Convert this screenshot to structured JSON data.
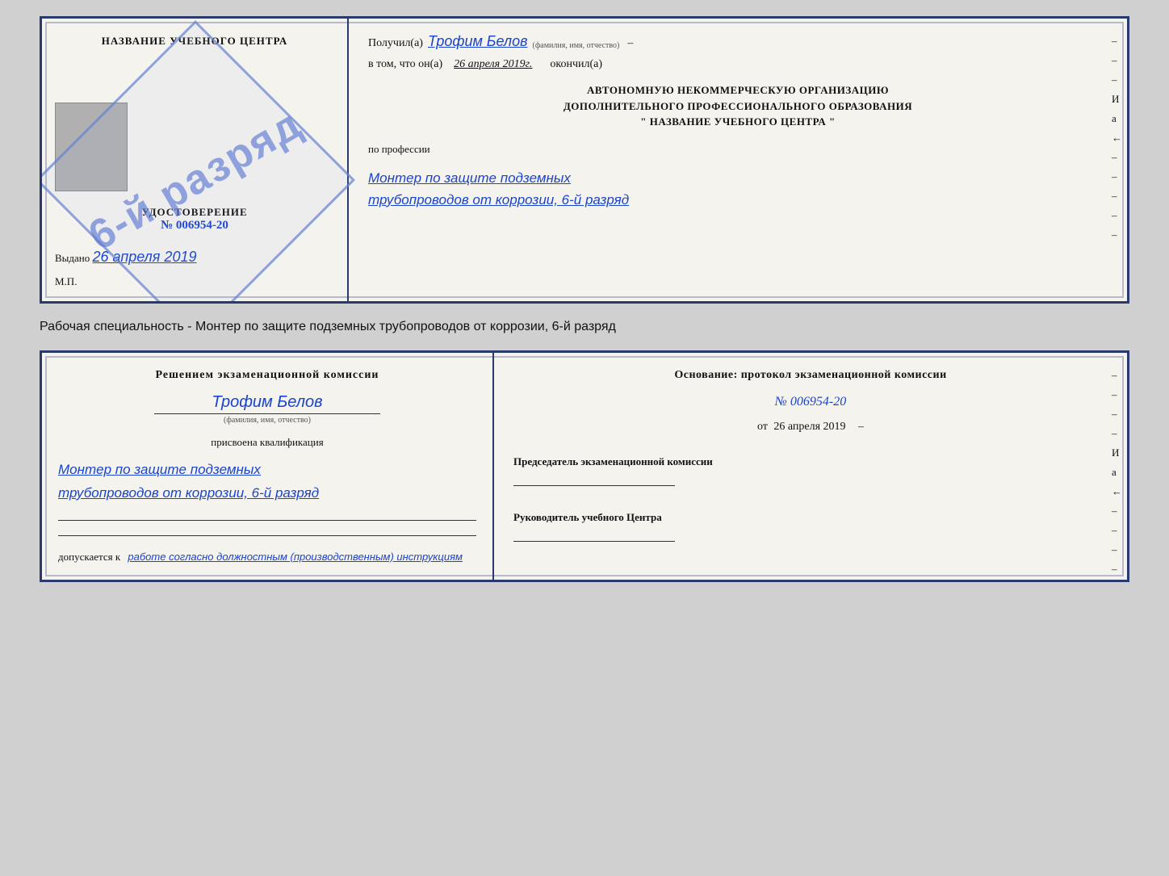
{
  "top_cert": {
    "left": {
      "heading": "НАЗВАНИЕ УЧЕБНОГО ЦЕНТРА",
      "photo_alt": "фото",
      "stamp_text": "6-й разряд",
      "udost_title": "УДОСТОВЕРЕНИЕ",
      "udost_num": "№ 006954-20",
      "vydano_label": "Выдано",
      "vydano_date": "26 апреля 2019",
      "mp": "М.П."
    },
    "right": {
      "poluchil_label": "Получил(а)",
      "recipient_name": "Трофим Белов",
      "fio_label": "(фамилия, имя, отчество)",
      "vtom_label": "в том, что он(а)",
      "vtom_date": "26 апреля 2019г.",
      "okonchil": "окончил(а)",
      "org_line1": "АВТОНОМНУЮ НЕКОММЕРЧЕСКУЮ ОРГАНИЗАЦИЮ",
      "org_line2": "ДОПОЛНИТЕЛЬНОГО ПРОФЕССИОНАЛЬНОГО ОБРАЗОВАНИЯ",
      "org_line3": "\"    НАЗВАНИЕ УЧЕБНОГО ЦЕНТРА    \"",
      "po_professii": "по профессии",
      "profession_line1": "Монтер по защите подземных",
      "profession_line2": "трубопроводов от коррозии, 6-й разряд",
      "dashes": [
        "-",
        "-",
        "-",
        "И",
        "а",
        "←",
        "-",
        "-",
        "-",
        "-",
        "-"
      ]
    }
  },
  "middle": {
    "text": "Рабочая специальность - Монтер по защите подземных трубопроводов от коррозии, 6-й разряд"
  },
  "bottom_cert": {
    "left": {
      "heading": "Решением экзаменационной комиссии",
      "name": "Трофим Белов",
      "fio_label": "(фамилия, имя, отчество)",
      "prisvoena": "присвоена квалификация",
      "qualification_line1": "Монтер по защите подземных",
      "qualification_line2": "трубопроводов от коррозии, 6-й разряд",
      "dopusk_label": "допускается к",
      "dopusk_text": "работе согласно должностным (производственным) инструкциям"
    },
    "right": {
      "osnovanie": "Основание: протокол экзаменационной комиссии",
      "protocol_num": "№  006954-20",
      "ot_label": "от",
      "ot_date": "26 апреля 2019",
      "predsedatel_title": "Председатель экзаменационной комиссии",
      "rukovoditel_title": "Руководитель учебного Центра",
      "dashes": [
        "-",
        "-",
        "-",
        "-",
        "И",
        "а",
        "←",
        "-",
        "-",
        "-",
        "-",
        "-"
      ]
    }
  }
}
